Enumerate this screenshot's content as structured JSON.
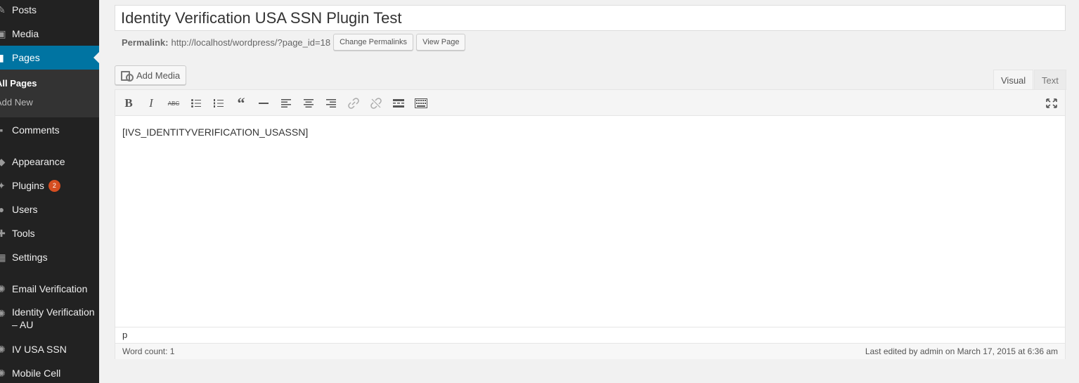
{
  "sidebar": {
    "items": [
      {
        "label": "Posts",
        "icon": "pin-icon"
      },
      {
        "label": "Media",
        "icon": "media-icon"
      },
      {
        "label": "Pages",
        "icon": "page-icon"
      },
      {
        "label": "Comments",
        "icon": "comment-icon"
      },
      {
        "label": "Appearance",
        "icon": "brush-icon"
      },
      {
        "label": "Plugins",
        "icon": "plugin-icon",
        "badge": "2"
      },
      {
        "label": "Users",
        "icon": "users-icon"
      },
      {
        "label": "Tools",
        "icon": "wrench-icon"
      },
      {
        "label": "Settings",
        "icon": "settings-icon"
      },
      {
        "label": "Email Verification",
        "icon": "gear-icon"
      },
      {
        "label": "Identity Verification – AU",
        "icon": "gear-icon"
      },
      {
        "label": "IV USA SSN",
        "icon": "gear-icon"
      },
      {
        "label": "Mobile Cell",
        "icon": "gear-icon"
      }
    ],
    "submenu": [
      {
        "label": "All Pages"
      },
      {
        "label": "Add New"
      }
    ],
    "colors": {
      "bg": "#222222",
      "current": "#0074a2",
      "badge": "#d54e21"
    }
  },
  "title": {
    "value": "Identity Verification USA SSN Plugin Test"
  },
  "permalink": {
    "label": "Permalink:",
    "url": "http://localhost/wordpress/?page_id=18",
    "change_button": "Change Permalinks",
    "view_button": "View Page"
  },
  "editor": {
    "add_media": "Add Media",
    "tabs": {
      "visual": "Visual",
      "text": "Text"
    },
    "toolbar": [
      "bold-icon",
      "italic-icon",
      "strikethrough-icon",
      "bullet-list-icon",
      "numbered-list-icon",
      "blockquote-icon",
      "horizontal-rule-icon",
      "align-left-icon",
      "align-center-icon",
      "align-right-icon",
      "link-icon",
      "unlink-icon",
      "read-more-icon",
      "toolbar-toggle-icon",
      "fullscreen-icon"
    ],
    "content": "[IVS_IDENTITYVERIFICATION_USASSN]",
    "path": "p",
    "word_count": "Word count: 1",
    "last_edited": "Last edited by admin on March 17, 2015 at 6:36 am"
  }
}
